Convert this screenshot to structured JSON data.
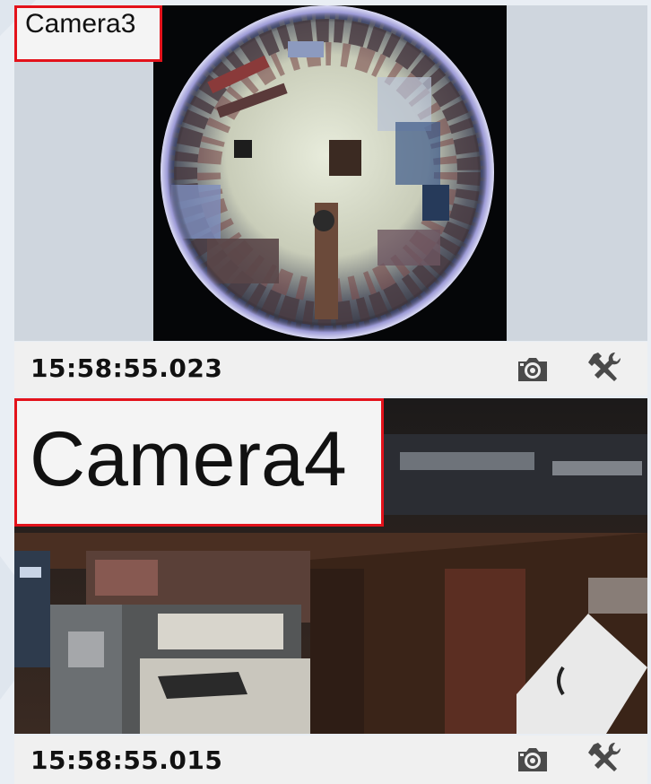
{
  "cameras": [
    {
      "label": "Camera3",
      "timestamp": "15:58:55.023",
      "toolbar": {
        "snapshot_icon": "camera-icon",
        "settings_icon": "tools-icon"
      }
    },
    {
      "label": "Camera4",
      "timestamp": "15:58:55.015",
      "toolbar": {
        "snapshot_icon": "camera-icon",
        "settings_icon": "tools-icon"
      }
    }
  ],
  "colors": {
    "label_border": "#e3121b",
    "label_bg": "#f4f4f4",
    "statusbar_bg": "#f0f0f0",
    "pane_bg": "#cfd6de"
  }
}
